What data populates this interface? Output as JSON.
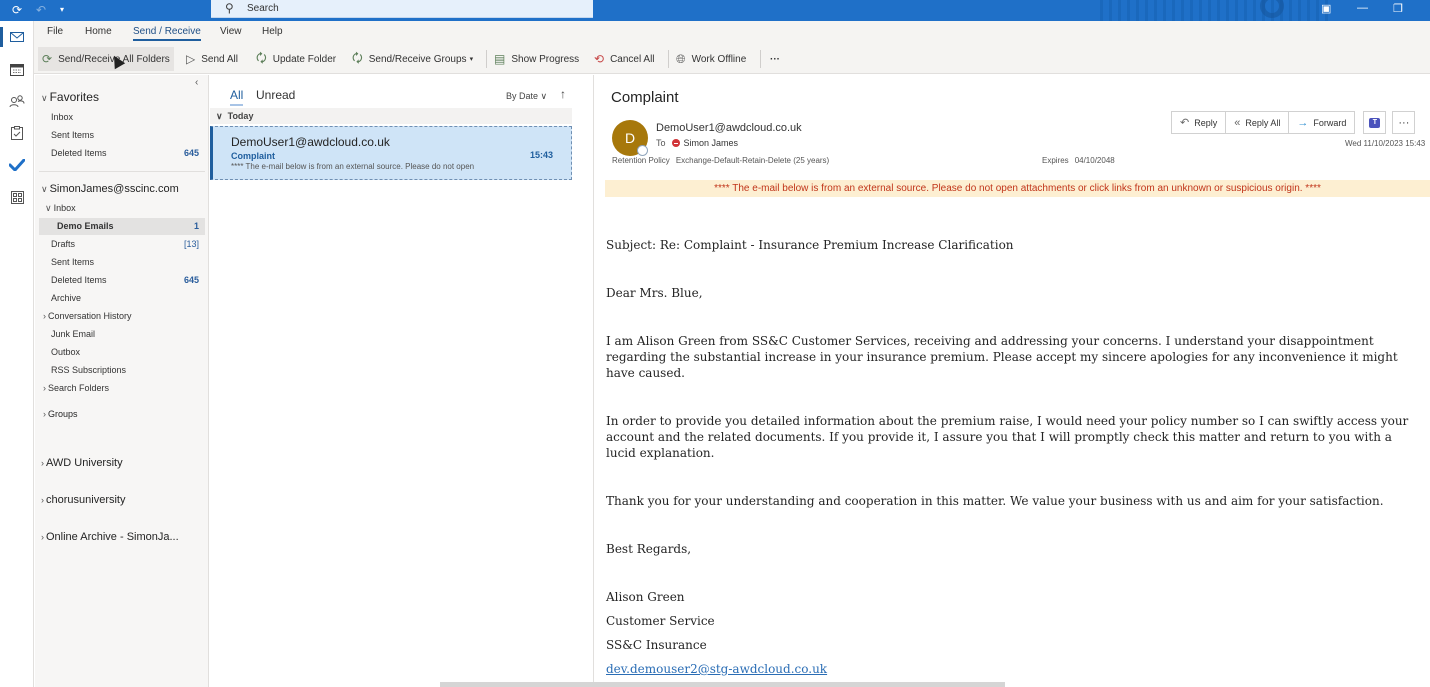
{
  "titlebar": {
    "search_placeholder": "Search",
    "icons": [
      "sync-icon",
      "undo-icon",
      "quick-access-dropdown-icon"
    ],
    "window_controls": [
      "ribbon-display-icon",
      "minimize-icon",
      "restore-icon"
    ]
  },
  "rail": {
    "items": [
      "mail",
      "calendar",
      "people",
      "tasks",
      "to-do",
      "apps"
    ]
  },
  "menu": {
    "items": [
      "File",
      "Home",
      "Send / Receive",
      "View",
      "Help"
    ],
    "active": "Send / Receive"
  },
  "ribbon": {
    "send_receive_all": "Send/Receive All Folders",
    "send_all": "Send All",
    "update_folder": "Update Folder",
    "send_receive_groups": "Send/Receive Groups",
    "show_progress": "Show Progress",
    "cancel_all": "Cancel All",
    "work_offline": "Work Offline",
    "more": "···"
  },
  "folders": {
    "favorites_header": "Favorites",
    "favorites": [
      {
        "label": "Inbox",
        "count": ""
      },
      {
        "label": "Sent Items",
        "count": ""
      },
      {
        "label": "Deleted Items",
        "count": "645"
      }
    ],
    "account": "SimonJames@sscinc.com",
    "inbox_label": "Inbox",
    "demo_emails": {
      "label": "Demo Emails",
      "count": "1"
    },
    "items": [
      {
        "label": "Drafts",
        "count": "[13]"
      },
      {
        "label": "Sent Items",
        "count": ""
      },
      {
        "label": "Deleted Items",
        "count": "645"
      },
      {
        "label": "Archive",
        "count": ""
      },
      {
        "label": "Conversation History",
        "count": ""
      },
      {
        "label": "Junk Email",
        "count": ""
      },
      {
        "label": "Outbox",
        "count": ""
      },
      {
        "label": "RSS Subscriptions",
        "count": ""
      },
      {
        "label": "Search Folders",
        "count": ""
      }
    ],
    "groups": "Groups",
    "other_accounts": [
      "AWD University",
      "chorusuniversity",
      "Online Archive - SimonJa..."
    ]
  },
  "list": {
    "tabs": [
      "All",
      "Unread"
    ],
    "active_tab": "All",
    "sort_label": "By Date",
    "sort_direction": "↑",
    "group_header": "Today",
    "messages": [
      {
        "from": "DemoUser1@awdcloud.co.uk",
        "subject": "Complaint",
        "time": "15:43",
        "preview": "**** The e-mail below is from an external source. Please do not open"
      }
    ]
  },
  "reader": {
    "title": "Complaint",
    "avatar_initial": "D",
    "avatar_color": "#a7780b",
    "from": "DemoUser1@awdcloud.co.uk",
    "to_label": "To",
    "to_name": "Simon James",
    "retention_label": "Retention Policy",
    "retention_value": "Exchange-Default-Retain-Delete (25 years)",
    "expires_label": "Expires",
    "expires_value": "04/10/2048",
    "date": "Wed 11/10/2023 15:43",
    "actions": {
      "reply": "Reply",
      "reply_all": "Reply All",
      "forward": "Forward"
    },
    "banner": "**** The e-mail below is from an external source. Please do not open attachments or click links from an unknown or suspicious origin. ****",
    "body": {
      "subject_line": "Subject: Re: Complaint - Insurance Premium Increase Clarification",
      "greeting": "Dear Mrs. Blue,",
      "para1": "I am Alison Green from SS&C Customer Services, receiving and addressing your concerns. I understand your disappointment regarding the substantial increase in your insurance premium. Please accept my sincere apologies for any inconvenience it might have caused.",
      "para2": "In order to provide you detailed information about the premium raise, I would need your policy number so I can swiftly access your account and the related documents. If you provide it, I assure you that I will promptly check this matter and return to you with a lucid explanation.",
      "para3": "Thank you for your understanding and cooperation in this matter. We value your business with us and aim for your satisfaction.",
      "closing": "Best Regards,",
      "sig_name": "Alison Green",
      "sig_title": "Customer Service",
      "sig_company": "SS&C Insurance",
      "sig_email": "dev.demouser2@stg-awdcloud.co.uk"
    }
  },
  "colors": {
    "titlebar": "#1f70c8",
    "accent": "#1f5e9e",
    "banner_bg": "#fdefd2",
    "banner_text": "#c1351a",
    "selected_message": "#cfe4f7"
  }
}
